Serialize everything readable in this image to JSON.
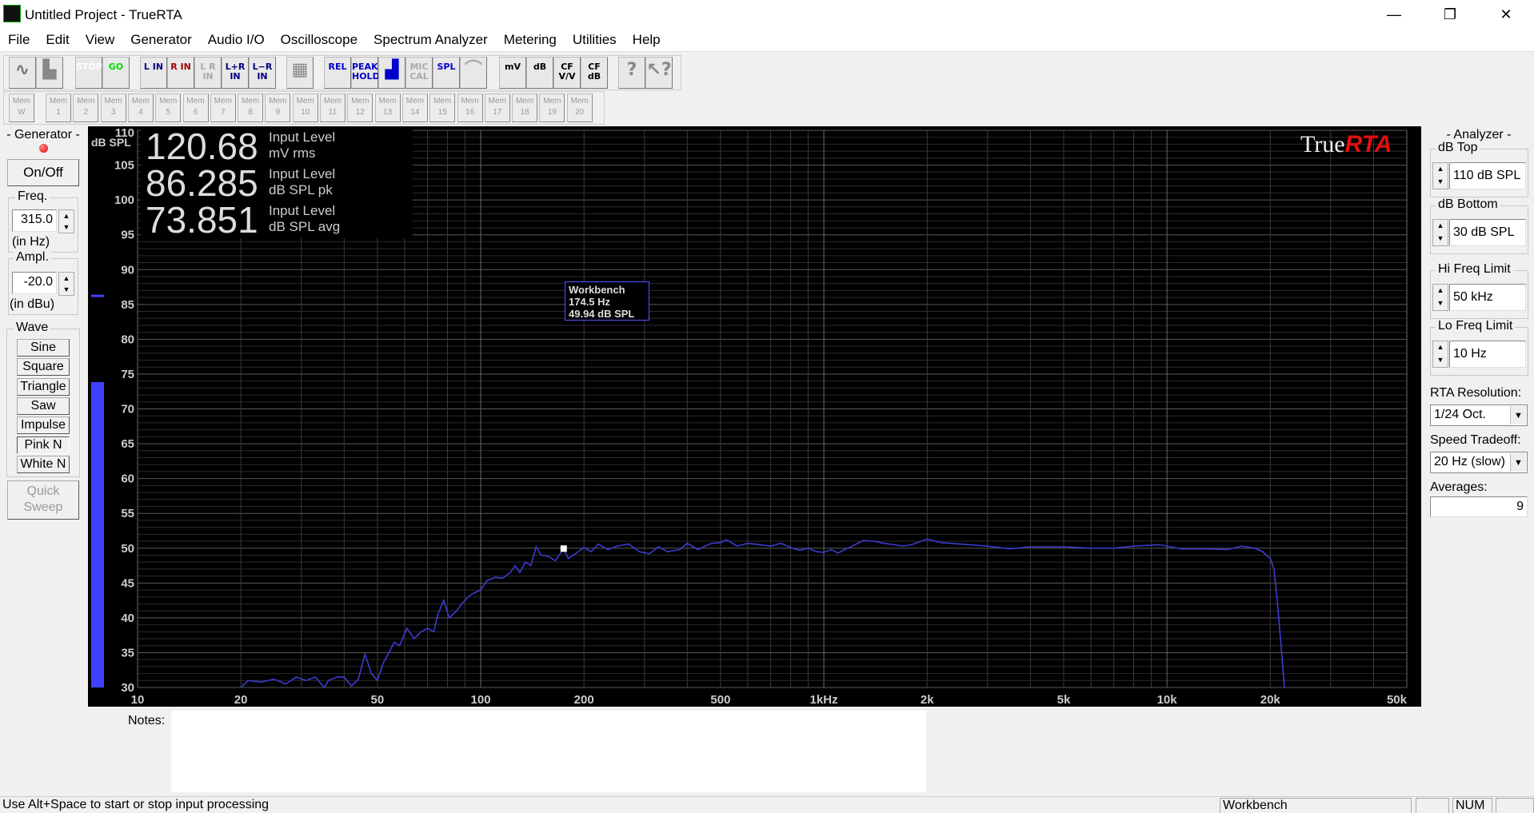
{
  "window": {
    "title": "Untitled Project - TrueRTA",
    "minimize": "—",
    "restore": "❐",
    "close": "✕"
  },
  "menu": [
    "File",
    "Edit",
    "View",
    "Generator",
    "Audio I/O",
    "Oscilloscope",
    "Spectrum Analyzer",
    "Metering",
    "Utilities",
    "Help"
  ],
  "toolbar": {
    "buttons": [
      {
        "id": "oscilloscope-mode",
        "label": "∿",
        "color": "#777"
      },
      {
        "id": "spectrum-mode",
        "label": "▙",
        "color": "#888"
      },
      {
        "id": "stop",
        "label": "STOP",
        "color": "#ff0000"
      },
      {
        "id": "go",
        "label": "GO",
        "color": "#00dd00"
      },
      {
        "id": "left-in",
        "label": "L IN",
        "color": "#000080"
      },
      {
        "id": "right-in",
        "label": "R IN",
        "color": "#a00000"
      },
      {
        "id": "lr-in",
        "label": "L R IN",
        "color": "#aaaaaa"
      },
      {
        "id": "l-plus-r-in",
        "label": "L+R IN",
        "color": "#000080"
      },
      {
        "id": "l-minus-r-in",
        "label": "L−R IN",
        "color": "#000080"
      },
      {
        "id": "grid",
        "label": "▦",
        "color": "#888"
      },
      {
        "id": "rel",
        "label": "REL",
        "color": "#0000cc"
      },
      {
        "id": "peak-hold",
        "label": "PEAK HOLD",
        "color": "#0000cc"
      },
      {
        "id": "bar-graph",
        "label": "▟",
        "color": "#0000cc"
      },
      {
        "id": "mic-cal",
        "label": "MIC CAL",
        "color": "#aaaaaa"
      },
      {
        "id": "spl",
        "label": "SPL",
        "color": "#0000cc"
      },
      {
        "id": "weighting",
        "label": "⌒",
        "color": "#aaaaaa"
      },
      {
        "id": "mv",
        "label": "mV",
        "color": "#000"
      },
      {
        "id": "db",
        "label": "dB",
        "color": "#000"
      },
      {
        "id": "cf-vv",
        "label": "CF V/V",
        "color": "#000"
      },
      {
        "id": "cf-db",
        "label": "CF dB",
        "color": "#000"
      },
      {
        "id": "help",
        "label": "?",
        "color": "#888"
      },
      {
        "id": "context-help",
        "label": "↖?",
        "color": "#888"
      }
    ],
    "memory": [
      "Mem W",
      "Mem 1",
      "Mem 2",
      "Mem 3",
      "Mem 4",
      "Mem 5",
      "Mem 6",
      "Mem 7",
      "Mem 8",
      "Mem 9",
      "Mem 10",
      "Mem 11",
      "Mem 12",
      "Mem 13",
      "Mem 14",
      "Mem 15",
      "Mem 16",
      "Mem 17",
      "Mem 18",
      "Mem 19",
      "Mem 20"
    ]
  },
  "generator": {
    "title": "- Generator -",
    "on_off": "On/Off",
    "freq_label": "Freq.",
    "freq_value": "315.0",
    "freq_unit": "(in Hz)",
    "ampl_label": "Ampl.",
    "ampl_value": "-20.0",
    "ampl_unit": "(in dBu)",
    "wave_label": "Wave",
    "waves": [
      "Sine",
      "Square",
      "Triangle",
      "Saw",
      "Impulse",
      "Pink N",
      "White N"
    ],
    "selected_wave": "Pink N",
    "quick_sweep": "Quick Sweep"
  },
  "readouts": [
    {
      "value": "120.68",
      "label1": "Input Level",
      "label2": "mV rms"
    },
    {
      "value": "86.285",
      "label1": "Input Level",
      "label2": "dB SPL pk"
    },
    {
      "value": "73.851",
      "label1": "Input Level",
      "label2": "dB SPL avg"
    }
  ],
  "logo": {
    "part1": "True",
    "part2": "RTA"
  },
  "tooltip": {
    "name": "Workbench",
    "freq": "174.5 Hz",
    "level": "49.94 dB SPL"
  },
  "meter": {
    "avg_db": 73.851,
    "peak_db": 86.285,
    "color": "#4040ff"
  },
  "chart_data": {
    "type": "line",
    "ylabel": "dB SPL",
    "ylim": [
      30,
      110
    ],
    "xlim": [
      10,
      50000
    ],
    "xscale": "log",
    "yticks": [
      110,
      105,
      100,
      95,
      90,
      85,
      80,
      75,
      70,
      65,
      60,
      55,
      50,
      45,
      40,
      35,
      30
    ],
    "xticks": [
      {
        "v": 10,
        "t": "10"
      },
      {
        "v": 20,
        "t": "20"
      },
      {
        "v": 50,
        "t": "50"
      },
      {
        "v": 100,
        "t": "100"
      },
      {
        "v": 200,
        "t": "200"
      },
      {
        "v": 500,
        "t": "500"
      },
      {
        "v": 1000,
        "t": "1kHz"
      },
      {
        "v": 2000,
        "t": "2k"
      },
      {
        "v": 5000,
        "t": "5k"
      },
      {
        "v": 10000,
        "t": "10k"
      },
      {
        "v": 20000,
        "t": "20k"
      },
      {
        "v": 50000,
        "t": "50k"
      }
    ],
    "grid": true,
    "line_color": "#3c3cd0",
    "series": [
      {
        "x": [
          20,
          21,
          23,
          25,
          27,
          29,
          31,
          33,
          35,
          36,
          38,
          40,
          42,
          44,
          46,
          48,
          50,
          52,
          54,
          56,
          58,
          61,
          64,
          67,
          70,
          73,
          75,
          78,
          81,
          85,
          88,
          92,
          95,
          100,
          104,
          110,
          116,
          122,
          126,
          130,
          135,
          140,
          145,
          150,
          158,
          165,
          174.5,
          180,
          190,
          200,
          210,
          220,
          235,
          250,
          270,
          290,
          310,
          330,
          350,
          380,
          400,
          430,
          470,
          500,
          520,
          560,
          600,
          650,
          700,
          750,
          800,
          850,
          900,
          950,
          1000,
          1050,
          1100,
          1150,
          1200,
          1300,
          1400,
          1500,
          1600,
          1700,
          1800,
          2000,
          2200,
          2500,
          3000,
          3500,
          4000,
          5000,
          6000,
          7000,
          8000,
          9500,
          10000,
          11000,
          13000,
          15000,
          16500,
          18000,
          19000,
          20000,
          20500,
          21000,
          21500,
          22000
        ],
        "y": [
          30,
          31,
          30.8,
          31.2,
          30.5,
          31.5,
          31,
          31.5,
          30,
          31,
          31.5,
          31.5,
          30.2,
          31.2,
          34.8,
          32,
          31,
          33.5,
          35,
          36.5,
          36,
          38.5,
          37,
          38,
          38.5,
          38,
          40.5,
          42.5,
          40,
          41,
          42,
          43,
          43.5,
          44,
          45.3,
          45.8,
          45.7,
          46.5,
          47.5,
          46.5,
          48,
          47.5,
          50.2,
          49,
          48.8,
          48.2,
          49.94,
          48.5,
          49.3,
          50.1,
          49.5,
          50.6,
          49.8,
          50.3,
          50.6,
          49.5,
          49.2,
          50.2,
          49.5,
          49.8,
          50.7,
          49.8,
          50.7,
          50.8,
          51.2,
          50.3,
          50.7,
          50.5,
          50.3,
          50.7,
          50.1,
          49.7,
          50,
          49.5,
          49.4,
          49.8,
          49.3,
          49.8,
          50.2,
          51.1,
          51,
          50.7,
          50.5,
          50.3,
          50.5,
          51.3,
          50.8,
          50.6,
          50.3,
          49.9,
          50.2,
          50.2,
          50,
          50,
          50.3,
          50.5,
          50.3,
          49.9,
          49.9,
          49.8,
          50.3,
          50,
          49.5,
          48.5,
          47,
          42,
          36,
          30
        ]
      }
    ]
  },
  "notes": {
    "label": "Notes:",
    "value": ""
  },
  "analyzer": {
    "title": "- Analyzer -",
    "db_top_label": "dB Top",
    "db_top": "110 dB SPL",
    "db_bottom_label": "dB Bottom",
    "db_bottom": "30 dB SPL",
    "hi_freq_label": "Hi Freq Limit",
    "hi_freq": "50 kHz",
    "lo_freq_label": "Lo Freq Limit",
    "lo_freq": "10 Hz",
    "rta_res_label": "RTA Resolution:",
    "rta_res": "1/24 Oct.",
    "speed_label": "Speed Tradeoff:",
    "speed": "20 Hz (slow)",
    "averages_label": "Averages:",
    "averages": "9"
  },
  "status": {
    "hint": "Use Alt+Space to start or stop input processing",
    "mode": "Workbench",
    "num": "NUM"
  }
}
